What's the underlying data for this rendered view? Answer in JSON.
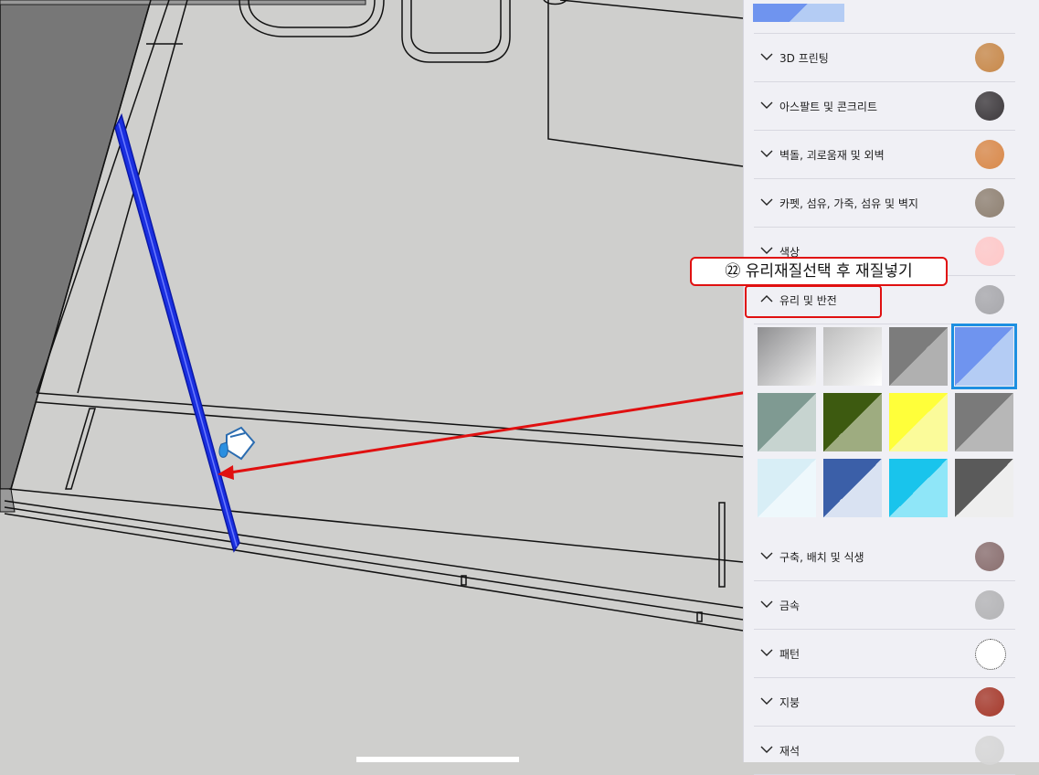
{
  "callout": {
    "text": "㉒ 유리재질선택 후 재질넣기"
  },
  "panel": {
    "categories_top": [
      {
        "label": "3D 프린팅",
        "swatch": "#c8894a",
        "icon": "chevron-down-icon"
      },
      {
        "label": "아스팔트 및 콘크리트",
        "swatch": "#3d393c",
        "icon": "chevron-down-icon"
      },
      {
        "label": "벽돌, 괴로움재 및 외벽",
        "swatch": "#d9894a",
        "icon": "chevron-down-icon"
      },
      {
        "label": "카펫, 섬유, 가죽, 섬유 및 벽지",
        "swatch": "#8f8172",
        "icon": "chevron-down-icon"
      },
      {
        "label": "색상",
        "swatch": "#ffc8c8",
        "icon": "chevron-down-icon"
      }
    ],
    "expanded_category": {
      "label": "유리 및 반전",
      "swatch": "#a8a8ac",
      "icon": "chevron-up-icon"
    },
    "categories_bottom": [
      {
        "label": "구축, 배치 및 식생",
        "swatch": "#8a6f6f",
        "icon": "chevron-down-icon"
      },
      {
        "label": "금속",
        "swatch": "#b4b4b6",
        "icon": "chevron-down-icon"
      },
      {
        "label": "패턴",
        "swatch": "#ffffff",
        "icon": "chevron-down-icon"
      },
      {
        "label": "지붕",
        "swatch": "#a63a2c",
        "icon": "chevron-down-icon"
      },
      {
        "label": "재석",
        "swatch": "#d6d6d6",
        "icon": "chevron-down-icon"
      }
    ],
    "tiles": [
      {
        "name": "glass-tile-1",
        "c1": "#8e8e90",
        "c2": "#f2f2f2"
      },
      {
        "name": "glass-tile-2",
        "c1": "#bdbdbd",
        "c2": "#ffffff"
      },
      {
        "name": "glass-tile-3",
        "c1": "#7c7c7c",
        "c2": "#b0b0b0"
      },
      {
        "name": "glass-tile-4",
        "c1": "#6f94ef",
        "c2": "#b4ccf4",
        "selected": true
      },
      {
        "name": "glass-tile-5",
        "c1": "#7f9a92",
        "c2": "#c7d4d0"
      },
      {
        "name": "glass-tile-6",
        "c1": "#3d5a10",
        "c2": "#9eac80"
      },
      {
        "name": "glass-tile-7",
        "c1": "#ffff3a",
        "c2": "#fbfb9a"
      },
      {
        "name": "glass-tile-8",
        "c1": "#7a7a7a",
        "c2": "#b7b7b7"
      },
      {
        "name": "glass-tile-9",
        "c1": "#d8eef6",
        "c2": "#eef8fc"
      },
      {
        "name": "glass-tile-10",
        "c1": "#3b5fa8",
        "c2": "#d9e2f2"
      },
      {
        "name": "glass-tile-11",
        "c1": "#19c4ec",
        "c2": "#8fe6f8"
      },
      {
        "name": "glass-tile-12",
        "c1": "#5a5a5a",
        "c2": "#eeeeee"
      }
    ]
  }
}
